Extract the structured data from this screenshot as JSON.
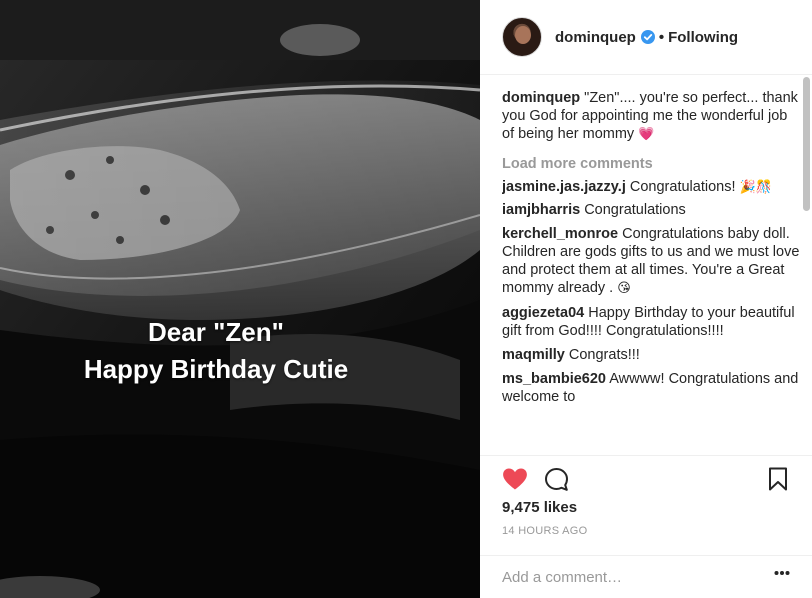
{
  "post": {
    "image_caption_line1": "Dear \"Zen\"",
    "image_caption_line2": "Happy Birthday Cutie"
  },
  "header": {
    "username": "dominquep",
    "separator": "•",
    "follow_status": "Following",
    "verified_icon": "verified-badge-icon",
    "verified_color": "#3897f0"
  },
  "caption": {
    "author": "dominquep",
    "text": " \"Zen\".... you're so perfect... thank you God for appointing me the wonderful job of being her mommy ",
    "emoji": "💗"
  },
  "load_more": "Load more comments",
  "comments": [
    {
      "author": "jasmine.jas.jazzy.j",
      "text": " Congratulations! ",
      "emoji": "🎉🎊"
    },
    {
      "author": "iamjbharris",
      "text": " Congratulations",
      "emoji": ""
    },
    {
      "author": "kerchell_monroe",
      "text": " Congratulations baby doll. Children are gods gifts to us and we must love and protect them at all times. You're a Great mommy already . ",
      "emoji": "😘"
    },
    {
      "author": "aggiezeta04",
      "text": " Happy Birthday to your beautiful gift from God!!!! Congratulations!!!!",
      "emoji": ""
    },
    {
      "author": "maqmilly",
      "text": " Congrats!!!",
      "emoji": ""
    },
    {
      "author": "ms_bambie620",
      "text": " Awwww! Congratulations and welcome to",
      "emoji": ""
    }
  ],
  "actions": {
    "like_icon": "heart-filled-icon",
    "comment_icon": "speech-bubble-icon",
    "save_icon": "bookmark-icon",
    "like_color": "#ed4956"
  },
  "likes": "9,475 likes",
  "timestamp": "14 HOURS AGO",
  "add_comment": {
    "placeholder": "Add a comment…",
    "value": ""
  },
  "more_icon": "more-options-icon"
}
